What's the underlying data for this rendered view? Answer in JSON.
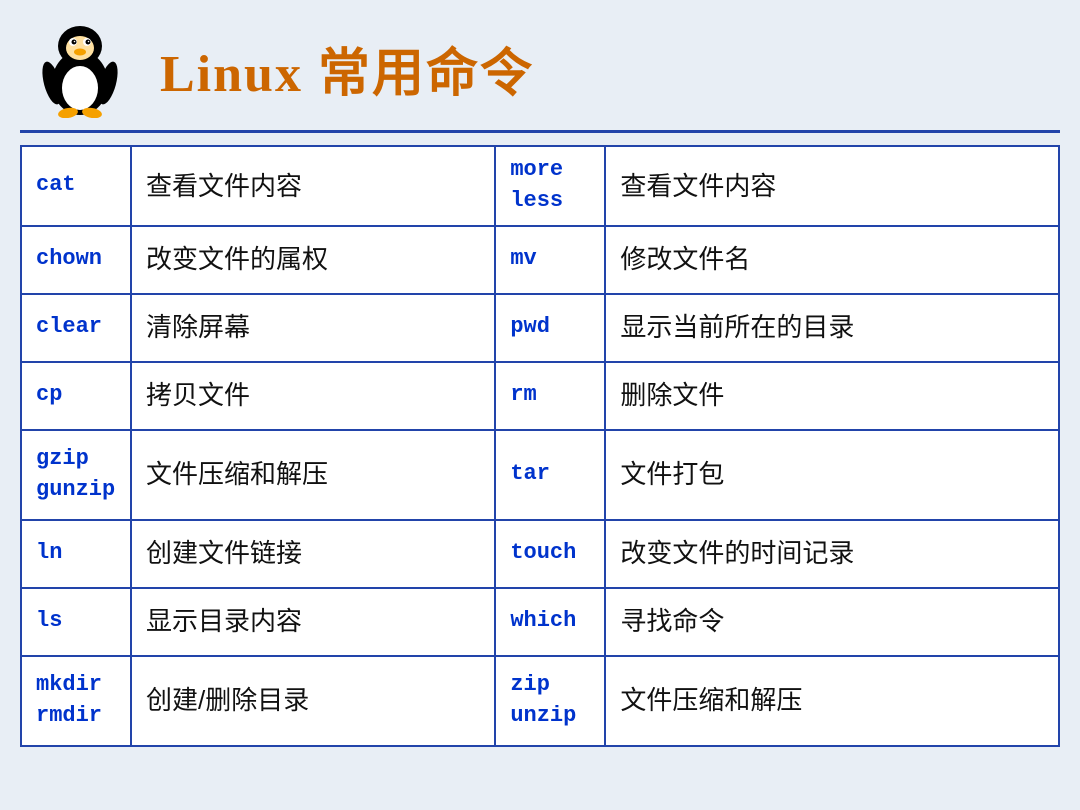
{
  "header": {
    "title": "Linux 常用命令"
  },
  "table": {
    "rows": [
      {
        "cmd1": "cat",
        "desc1": "查看文件内容",
        "cmd2": "more\nless",
        "desc2": "查看文件内容"
      },
      {
        "cmd1": "chown",
        "desc1": "改变文件的属权",
        "cmd2": "mv",
        "desc2": "修改文件名"
      },
      {
        "cmd1": "clear",
        "desc1": "清除屏幕",
        "cmd2": "pwd",
        "desc2": "显示当前所在的目录"
      },
      {
        "cmd1": "cp",
        "desc1": "拷贝文件",
        "cmd2": "rm",
        "desc2": "删除文件"
      },
      {
        "cmd1": "gzip\ngunzip",
        "desc1": "文件压缩和解压",
        "cmd2": "tar",
        "desc2": "文件打包"
      },
      {
        "cmd1": "ln",
        "desc1": "创建文件链接",
        "cmd2": "touch",
        "desc2": "改变文件的时间记录"
      },
      {
        "cmd1": "ls",
        "desc1": "显示目录内容",
        "cmd2": "which",
        "desc2": "寻找命令"
      },
      {
        "cmd1": "mkdir\nrmdir",
        "desc1": "创建/删除目录",
        "cmd2": "zip\nunzip",
        "desc2": "文件压缩和解压"
      }
    ]
  }
}
